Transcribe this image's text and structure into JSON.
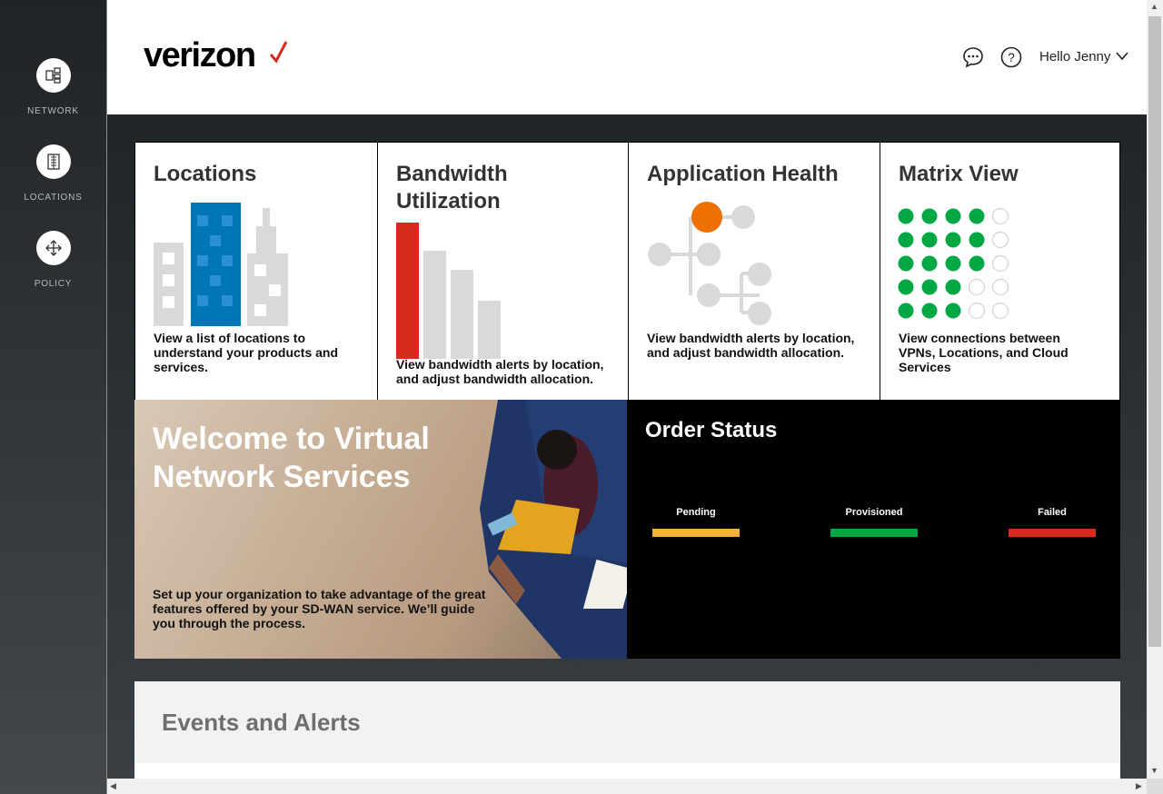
{
  "sidebar": {
    "items": [
      {
        "label": "NETWORK",
        "icon": "network-icon"
      },
      {
        "label": "LOCATIONS",
        "icon": "building-icon"
      },
      {
        "label": "POLICY",
        "icon": "move-arrows-icon"
      }
    ]
  },
  "header": {
    "logo": "verizon",
    "greeting": "Hello Jenny",
    "icons": [
      "chat-icon",
      "help-icon",
      "chevron-down-icon"
    ]
  },
  "tiles": [
    {
      "title": "Locations",
      "desc": "View a list of locations to understand your products and services."
    },
    {
      "title": "Bandwidth Utilization",
      "desc": "View bandwidth alerts by location, and adjust bandwidth allocation."
    },
    {
      "title": "Application Health",
      "desc": "View bandwidth alerts by location, and adjust bandwidth allocation."
    },
    {
      "title": "Matrix View",
      "desc": "View connections between VPNs, Locations, and Cloud Services"
    }
  ],
  "welcome": {
    "title": "Welcome to Virtual Network Services",
    "desc": "Set up your organization to take advantage of the great features offered by your SD-WAN service. We’ll guide you through the process."
  },
  "order_status": {
    "title": "Order Status",
    "statuses": [
      {
        "label": "Pending",
        "color": "#f5b335"
      },
      {
        "label": "Provisioned",
        "color": "#00a843"
      },
      {
        "label": "Failed",
        "color": "#d52b1e"
      }
    ]
  },
  "events": {
    "title": "Events and Alerts"
  },
  "colors": {
    "brand_red": "#d52b1e",
    "accent_blue": "#0077b4",
    "accent_orange": "#ed7000",
    "matrix_green": "#00a843"
  },
  "matrix_filled_per_row": [
    4,
    4,
    4,
    3,
    3
  ]
}
